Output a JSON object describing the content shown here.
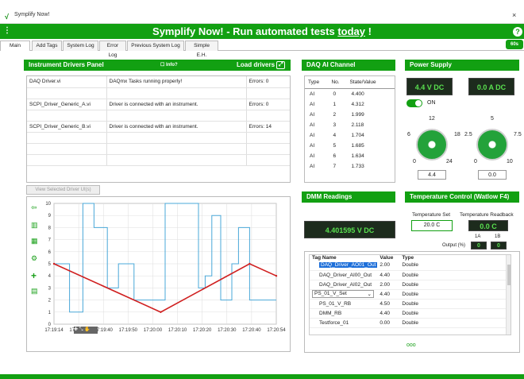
{
  "window": {
    "title": "Symplify Now!"
  },
  "banner": {
    "menu": "⋮",
    "prefix": "Symplify Now!  -  Run automated tests ",
    "emph": "today",
    "suffix": " !",
    "help": "?"
  },
  "tabs": [
    "Main",
    "Add Tags",
    "System Log",
    "Error Log",
    "Previous System Log",
    "Simple E.H."
  ],
  "interval": "60s",
  "drivers": {
    "title": "Instrument Drivers Panel",
    "info": "Info?",
    "load": "Load drivers",
    "rows": [
      {
        "name": "DAQ Driver.vi",
        "status": "DAQmx Tasks running properly!",
        "errors": "Errors: 0"
      },
      {
        "name": "SCPI_Driver_Generic_A.vi",
        "status": "Driver is connected with an instrument.",
        "errors": "Errors: 0"
      },
      {
        "name": "SCPI_Driver_Generic_B.vi",
        "status": "Driver is connected with an instrument.",
        "errors": "Errors: 14"
      }
    ],
    "view_btn": "View Selected Driver UI(s)"
  },
  "daq": {
    "title": "DAQ AI Channel",
    "cols": [
      "Type",
      "No.",
      "State/Value"
    ],
    "rows": [
      [
        "AI",
        "0",
        "4.400"
      ],
      [
        "AI",
        "1",
        "4.312"
      ],
      [
        "AI",
        "2",
        "1.999"
      ],
      [
        "AI",
        "3",
        "2.118"
      ],
      [
        "AI",
        "4",
        "1.704"
      ],
      [
        "AI",
        "5",
        "1.685"
      ],
      [
        "AI",
        "6",
        "1.634"
      ],
      [
        "AI",
        "7",
        "1.733"
      ]
    ]
  },
  "power": {
    "title": "Power Supply",
    "voltage": "4.4 V DC",
    "current": "0.0 A DC",
    "on": "ON",
    "knob1": {
      "ticks": [
        "0",
        "6",
        "12",
        "18",
        "24"
      ],
      "value": "4.4"
    },
    "knob2": {
      "ticks": [
        "0",
        "2.5",
        "5",
        "7.5",
        "10"
      ],
      "value": "0.0"
    }
  },
  "dmm": {
    "title": "DMM Readings",
    "value": "4.401595  V DC"
  },
  "temp": {
    "title": "Temperature Control (Watlow F4)",
    "set_label": "Temperature Set",
    "set": "20.0 C",
    "rb_label": "Temperature Readback",
    "rb": "0.0 C",
    "out_label": "Output (%)",
    "a": "1A",
    "b": "1B",
    "va": "0",
    "vb": "0"
  },
  "tags": {
    "cols": [
      "Tag Name",
      "Value",
      "Type"
    ],
    "rows": [
      [
        "DAQ_Driver_AO01_Out",
        "2.00",
        "Double"
      ],
      [
        "DAQ_Driver_AI00_Out",
        "4.40",
        "Double"
      ],
      [
        "DAQ_Driver_AI02_Out",
        "2.00",
        "Double"
      ],
      [
        "PS_01_V_Set",
        "4.40",
        "Double"
      ],
      [
        "PS_01_V_RB",
        "4.50",
        "Double"
      ],
      [
        "DMM_RB",
        "4.40",
        "Double"
      ],
      [
        "Testforce_01",
        "0.00",
        "Double"
      ]
    ],
    "dots": "ooo"
  },
  "chart_data": {
    "type": "line",
    "x_ticks": [
      "17:19:14",
      "17:19:30",
      "17:19:40",
      "17:19:50",
      "17:20:00",
      "17:20:10",
      "17:20:20",
      "17:20:30",
      "17:20:40",
      "17:20:54"
    ],
    "y_ticks": [
      "0",
      "1",
      "2",
      "3",
      "4",
      "5",
      "6",
      "7",
      "8",
      "9",
      "10"
    ],
    "ylim": [
      0,
      10
    ],
    "xlim": [
      0,
      100
    ],
    "series": [
      {
        "color": "#4aa8d8",
        "x": [
          0,
          7,
          7,
          13,
          13,
          18,
          18,
          24,
          24,
          29,
          29,
          36,
          36,
          42,
          42,
          46,
          46,
          50,
          50,
          58,
          58,
          60,
          60,
          65,
          65,
          68,
          68,
          71,
          71,
          75,
          75,
          80,
          80,
          83,
          83,
          88,
          88,
          91,
          91,
          100
        ],
        "values": [
          5,
          5,
          1,
          1,
          10,
          10,
          8,
          8,
          3,
          3,
          5,
          5,
          2,
          2,
          2,
          2,
          2,
          2,
          10,
          10,
          10,
          10,
          10,
          10,
          3,
          3,
          4,
          4,
          9,
          9,
          2,
          2,
          5,
          5,
          8,
          8,
          2,
          2,
          2,
          2
        ]
      },
      {
        "color": "#d02020",
        "x": [
          0,
          48,
          88,
          100
        ],
        "values": [
          5,
          1,
          5,
          4
        ]
      }
    ]
  }
}
